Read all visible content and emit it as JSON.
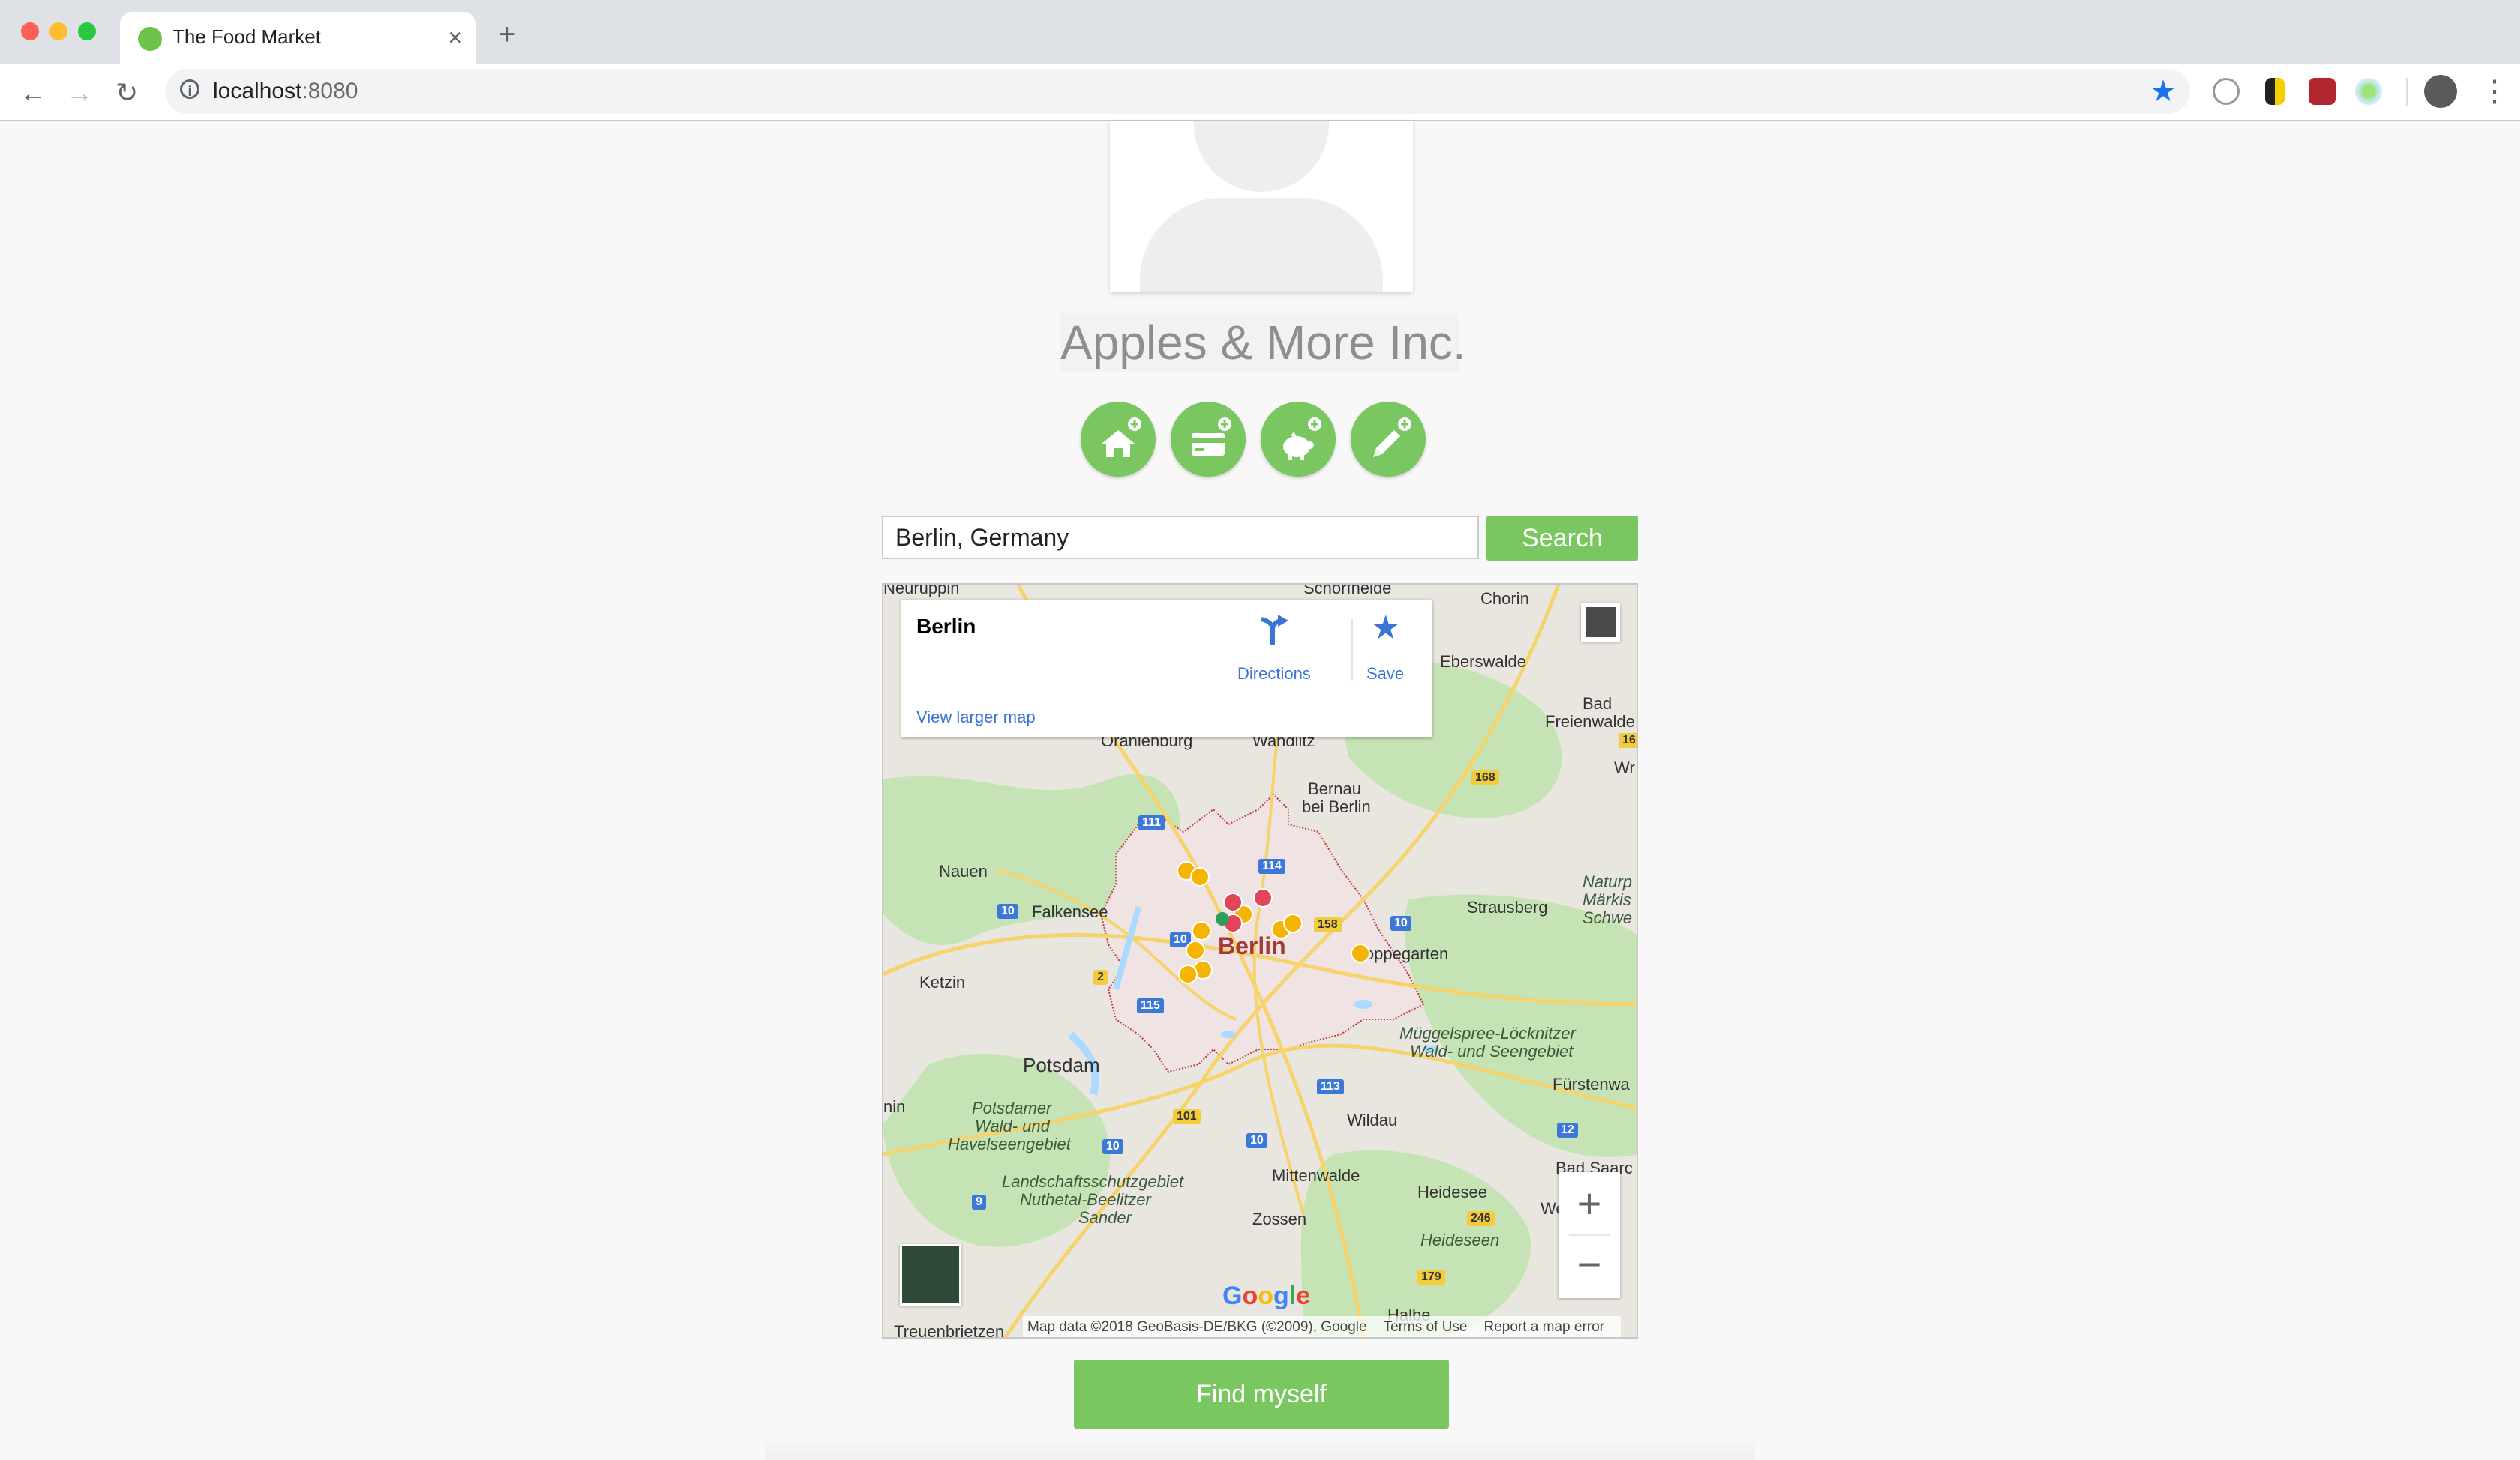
{
  "browser": {
    "tab_title": "The Food Market",
    "url_host": "localhost",
    "url_port": ":8080",
    "new_tab_symbol": "+",
    "close_symbol": "×",
    "icons": [
      "back-icon",
      "forward-icon",
      "reload-icon",
      "info-icon",
      "bookmark-star-icon",
      "extension-icon",
      "profile-avatar",
      "menu-icon"
    ],
    "colors": {
      "tabstrip": "#dee1e6",
      "close": "#ff5f57",
      "minimize": "#febc2e",
      "maximize": "#28c840",
      "bookmark_star": "#1a73e8"
    }
  },
  "profile": {
    "company_name": "Apples & More Inc.",
    "actions": [
      {
        "name": "add-home-button",
        "icon": "home-plus-icon"
      },
      {
        "name": "add-card-button",
        "icon": "credit-card-plus-icon"
      },
      {
        "name": "add-savings-button",
        "icon": "piggy-bank-plus-icon"
      },
      {
        "name": "add-edit-button",
        "icon": "pencil-plus-icon"
      }
    ]
  },
  "search": {
    "value": "Berlin, Germany",
    "button_label": "Search"
  },
  "map": {
    "place_name": "Berlin",
    "directions_label": "Directions",
    "save_label": "Save",
    "larger_map_label": "View larger map",
    "zoom_in": "+",
    "zoom_out": "−",
    "google_letters": [
      "G",
      "o",
      "o",
      "g",
      "l",
      "e"
    ],
    "attribution": {
      "data": "Map data ©2018 GeoBasis-DE/BKG (©2009), Google",
      "terms": "Terms of Use",
      "report": "Report a map error"
    },
    "labels": {
      "neuruppin": "Neuruppin",
      "schorfheide": "Schorfheide",
      "chorin": "Chorin",
      "eberswalde": "Eberswalde",
      "bad_freienwalde_1": "Bad",
      "bad_freienwalde_2": "Freienwalde",
      "oranienburg": "Oranienburg",
      "wandlitz": "Wandlitz",
      "bernau_1": "Bernau",
      "bernau_2": "bei Berlin",
      "nauen": "Nauen",
      "falkensee": "Falkensee",
      "berlin": "Berlin",
      "strausberg": "Strausberg",
      "naturpark_1": "Naturp",
      "naturpark_2": "Märkis",
      "naturpark_3": "Schwe",
      "ketzin": "Ketzin",
      "hoppegarten": "Hoppegarten",
      "mueggelspree_1": "Müggelspree-Löcknitzer",
      "mueggelspree_2": "Wald- und Seengebiet",
      "potsdam": "Potsdam",
      "fuerstenwalde": "Fürstenwa",
      "potsdamer_1": "Potsdamer",
      "potsdamer_2": "Wald- und",
      "potsdamer_3": "Havelseengebiet",
      "wildau": "Wildau",
      "mittenwalde": "Mittenwalde",
      "bad_saarow": "Bad Saarc",
      "lsg_1": "Landschaftsschutzgebiet",
      "lsg_2": "Nuthetal-Beelitzer",
      "lsg_3": "Sander",
      "heidesee": "Heidesee",
      "heideseen": "Heideseen",
      "zossen": "Zossen",
      "treuenbrietzen": "Treuenbrietzen",
      "halbe": "Halbe",
      "nin": "nin",
      "wr": "Wr",
      "we": "We"
    },
    "road_numbers": {
      "r111": "111",
      "r114": "114",
      "r168": "168",
      "r158": "158",
      "r10a": "10",
      "r10b": "10",
      "r10c": "10",
      "r10d": "10",
      "r10e": "10",
      "r2": "2",
      "r115": "115",
      "r113": "113",
      "r101": "101",
      "r12": "12",
      "r246": "246",
      "r9": "9",
      "r179": "179",
      "r16": "16"
    },
    "colors": {
      "land": "#e8e6df",
      "water": "#aadaff",
      "forest": "#c6e3b5",
      "urban": "#efe3e3",
      "boundary": "#c8333a",
      "pin_red": "#e2445a",
      "pin_yellow": "#f4b400",
      "link": "#3a75d6"
    }
  },
  "find_myself_label": "Find myself",
  "accent_color": "#7ac660"
}
